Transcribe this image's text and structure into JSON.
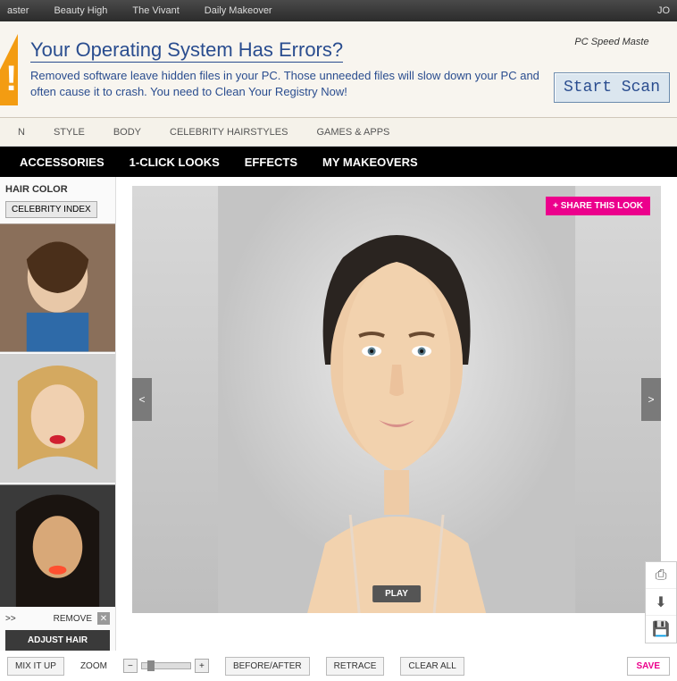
{
  "topbar": {
    "links": [
      "aster",
      "Beauty High",
      "The Vivant",
      "Daily Makeover"
    ],
    "right": "JO"
  },
  "ad": {
    "headline": "Your Operating System Has Errors?",
    "body": "Removed software leave hidden files in your PC. Those unneeded files will slow down your PC and often cause it to crash. You need to Clean Your Registry Now!",
    "brand": "PC Speed Maste",
    "cta": "Start Scan"
  },
  "nav1": [
    "N",
    "STYLE",
    "BODY",
    "CELEBRITY HAIRSTYLES",
    "GAMES & APPS"
  ],
  "nav2": [
    "ACCESSORIES",
    "1-CLICK LOOKS",
    "EFFECTS",
    "MY MAKEOVERS"
  ],
  "sidebar": {
    "label": "HAIR COLOR",
    "celeb_btn": "CELEBRITY INDEX",
    "remove_prefix": ">>",
    "remove": "REMOVE",
    "adjust": "ADJUST HAIR"
  },
  "stage": {
    "share": "+ SHARE THIS LOOK",
    "prev": "<",
    "next": ">",
    "play": "PLAY"
  },
  "tools": {
    "print": "⎙",
    "download": "⬇",
    "save_icon": "💾"
  },
  "bottom": {
    "mix": "MIX IT UP",
    "zoom_label": "ZOOM",
    "before": "BEFORE/AFTER",
    "retrace": "RETRACE",
    "clear": "CLEAR ALL",
    "save": "SAVE"
  }
}
